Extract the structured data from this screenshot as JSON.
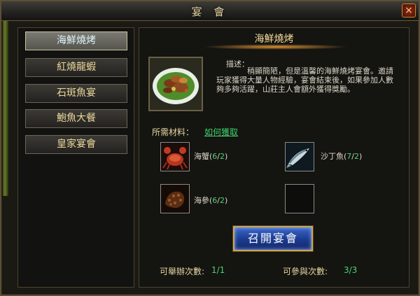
{
  "window": {
    "title": "宴 會",
    "close_label": "×"
  },
  "menu": {
    "items": [
      {
        "label": "海鮮燒烤",
        "active": true
      },
      {
        "label": "紅燒龍蝦",
        "active": false
      },
      {
        "label": "石斑魚宴",
        "active": false
      },
      {
        "label": "鮑魚大餐",
        "active": false
      },
      {
        "label": "皇家宴會",
        "active": false
      }
    ]
  },
  "feast": {
    "title": "海鮮燒烤",
    "desc_label": "描述：",
    "description": "稍顯簡陋，但是溫馨的海鮮燒烤宴會。邀請玩家獲得大量人物經驗，宴會結束後，如果參加人數夠多夠活躍，山莊主人會額外獲得獎勵。"
  },
  "materials": {
    "label": "所需材料：",
    "how_to_get": "如何獲取",
    "items": [
      {
        "name": "海蟹",
        "have": "6",
        "need": "2",
        "icon": "crab-icon"
      },
      {
        "name": "沙丁魚",
        "have": "7",
        "need": "2",
        "icon": "sardine-icon"
      },
      {
        "name": "海參",
        "have": "6",
        "need": "2",
        "icon": "sea-cucumber-icon"
      }
    ]
  },
  "actions": {
    "convene": "召開宴會"
  },
  "stats": {
    "host_label": "可舉辦次數:",
    "host_value": "1/1",
    "join_label": "可參與次數:",
    "join_value": "3/3"
  },
  "colors": {
    "accent_gold": "#ecd79a",
    "count_green": "#4bd46f",
    "button_blue": "#1b3a8e"
  }
}
